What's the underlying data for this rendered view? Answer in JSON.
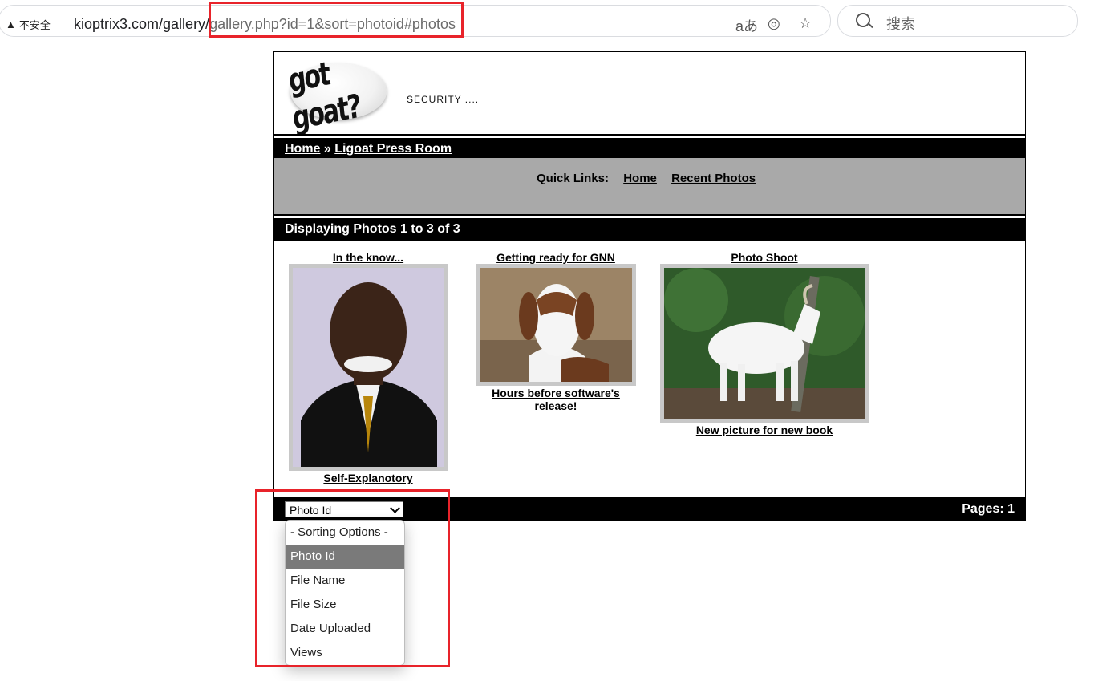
{
  "browser": {
    "warning": "不安全",
    "url_host": "kioptrix3.com/gallery/",
    "url_path": "gallery.php?id=1&sort=photoid#photos",
    "search_placeholder": "搜索"
  },
  "header": {
    "logo_text": "got goat?",
    "tagline": "SECURITY ...."
  },
  "breadcrumb": {
    "home": "Home",
    "separator": " » ",
    "current": "Ligoat Press Room"
  },
  "quick_links": {
    "label": "Quick Links:",
    "home": "Home",
    "recent": "Recent Photos"
  },
  "displaying": "Displaying Photos 1 to 3 of 3",
  "photos": [
    {
      "title": "In the know...",
      "caption": "Self-Explanotory"
    },
    {
      "title": "Getting ready for GNN",
      "caption": "Hours before software's release!"
    },
    {
      "title": "Photo Shoot",
      "caption": "New picture for new book"
    }
  ],
  "footer": {
    "sort_selected": "Photo Id",
    "pages": "Pages: 1"
  },
  "sort_options": [
    {
      "label": "- Sorting Options -"
    },
    {
      "label": "Photo Id"
    },
    {
      "label": "File Name"
    },
    {
      "label": "File Size"
    },
    {
      "label": "Date Uploaded"
    },
    {
      "label": "Views"
    }
  ],
  "colors": {
    "annotation": "#e8232a",
    "bar": "#000000",
    "quicklinks_bg": "#a9a9a9"
  }
}
